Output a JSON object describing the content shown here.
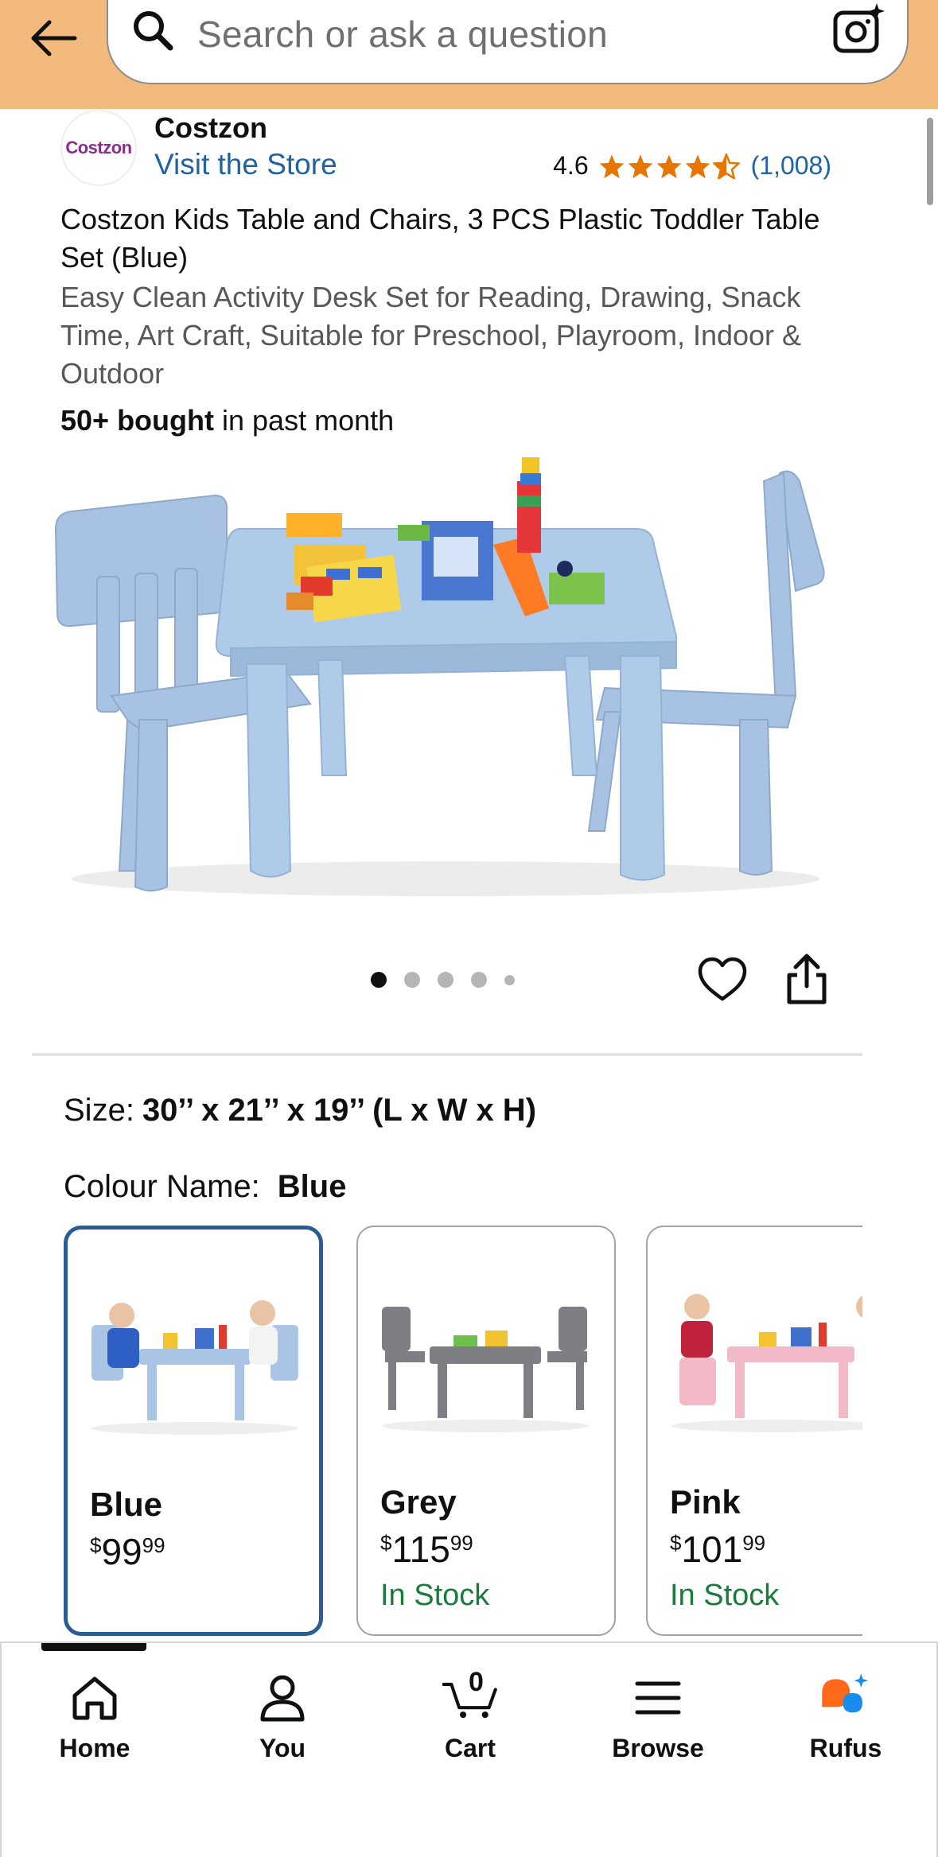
{
  "header": {
    "search_placeholder": "Search or ask a question"
  },
  "brand": {
    "logo_text": "Costzon",
    "name": "Costzon",
    "visit_store": "Visit the Store",
    "rating": "4.6",
    "rating_stars": 4.6,
    "rating_count": "(1,008)"
  },
  "product": {
    "title": "Costzon Kids Table and Chairs, 3 PCS Plastic Toddler Table Set (Blue)",
    "subtitle": "Easy Clean Activity Desk Set for Reading, Drawing, Snack Time, Art Craft, Suitable for Preschool, Playroom, Indoor & Outdoor",
    "bought_bold": "50+ bought",
    "bought_rest": " in past month",
    "image_count": 5,
    "active_image": 1
  },
  "options": {
    "size_label": "Size:",
    "size_value": "30’’ x 21’’ x 19’’ (L x W x H)",
    "colour_label": "Colour Name:",
    "colour_value": "Blue",
    "swatches": [
      {
        "name": "Blue",
        "currency": "$",
        "whole": "99",
        "fraction": "99",
        "stock": "",
        "color": "#a9c4e4"
      },
      {
        "name": "Grey",
        "currency": "$",
        "whole": "115",
        "fraction": "99",
        "stock": "In Stock",
        "color": "#7d7f84"
      },
      {
        "name": "Pink",
        "currency": "$",
        "whole": "101",
        "fraction": "99",
        "stock": "In Stock",
        "color": "#f2b9c6"
      }
    ]
  },
  "nav": {
    "home": "Home",
    "you": "You",
    "cart": "Cart",
    "cart_count": "0",
    "browse": "Browse",
    "rufus": "Rufus"
  },
  "colors": {
    "header_bg": "#f3ba7e",
    "link": "#2162a1",
    "star": "#e77600",
    "selected_border": "#2a5d94",
    "in_stock": "#197a3b",
    "rufus_orange": "#ff6a1a",
    "rufus_blue": "#1a8cf0"
  }
}
